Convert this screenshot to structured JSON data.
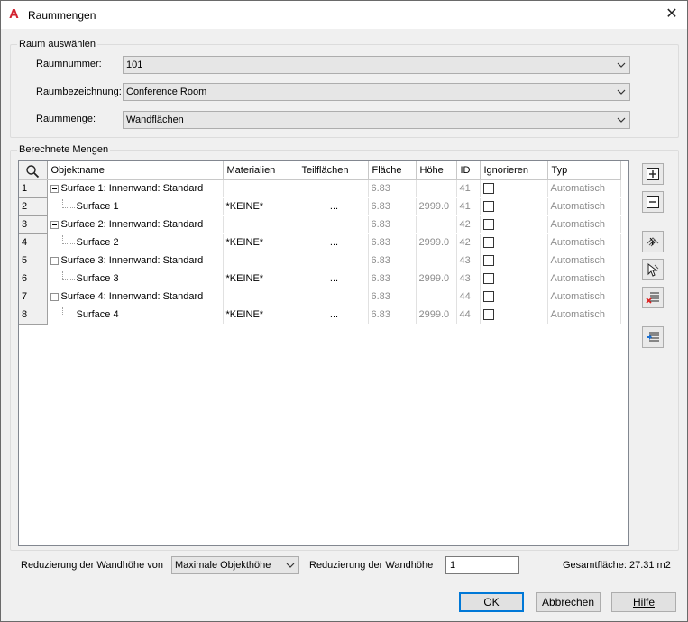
{
  "window": {
    "title": "Raummengen",
    "app_icon_glyph": "A",
    "close_glyph": "✕"
  },
  "select_room": {
    "group_label": "Raum auswählen",
    "room_number_label": "Raumnummer:",
    "room_number_value": "101",
    "room_name_label": "Raumbezeichnung:",
    "room_name_value": "Conference Room",
    "room_quantity_label": "Raummenge:",
    "room_quantity_value": "Wandflächen"
  },
  "computed": {
    "group_label": "Berechnete Mengen",
    "columns": [
      "Objektname",
      "Materialien",
      "Teilflächen",
      "Fläche",
      "Höhe",
      "ID",
      "Ignorieren",
      "Typ"
    ],
    "rows": [
      {
        "num": "1",
        "name": "Surface 1: Innenwand: Standard",
        "level": 0,
        "material": "",
        "parts": "",
        "area": "6.83",
        "height": "",
        "id": "41",
        "type": "Automatisch"
      },
      {
        "num": "2",
        "name": "Surface 1",
        "level": 1,
        "material": "*KEINE*",
        "parts": "...",
        "area": "6.83",
        "height": "2999.0",
        "id": "41",
        "type": "Automatisch"
      },
      {
        "num": "3",
        "name": "Surface 2: Innenwand: Standard",
        "level": 0,
        "material": "",
        "parts": "",
        "area": "6.83",
        "height": "",
        "id": "42",
        "type": "Automatisch"
      },
      {
        "num": "4",
        "name": "Surface 2",
        "level": 1,
        "material": "*KEINE*",
        "parts": "...",
        "area": "6.83",
        "height": "2999.0",
        "id": "42",
        "type": "Automatisch"
      },
      {
        "num": "5",
        "name": "Surface 3: Innenwand: Standard",
        "level": 0,
        "material": "",
        "parts": "",
        "area": "6.83",
        "height": "",
        "id": "43",
        "type": "Automatisch"
      },
      {
        "num": "6",
        "name": "Surface 3",
        "level": 1,
        "material": "*KEINE*",
        "parts": "...",
        "area": "6.83",
        "height": "2999.0",
        "id": "43",
        "type": "Automatisch"
      },
      {
        "num": "7",
        "name": "Surface 4: Innenwand: Standard",
        "level": 0,
        "material": "",
        "parts": "",
        "area": "6.83",
        "height": "",
        "id": "44",
        "type": "Automatisch"
      },
      {
        "num": "8",
        "name": "Surface 4",
        "level": 1,
        "material": "*KEINE*",
        "parts": "...",
        "area": "6.83",
        "height": "2999.0",
        "id": "44",
        "type": "Automatisch"
      }
    ]
  },
  "side_tools": [
    "expand-all-icon",
    "collapse-all-icon",
    "select-surface-icon",
    "pick-object-icon",
    "remove-list-icon",
    "edit-list-icon"
  ],
  "bottom": {
    "wall_reduction_from_label": "Reduzierung der Wandhöhe von",
    "wall_reduction_from_value": "Maximale Objekthöhe",
    "wall_reduction_label": "Reduzierung der Wandhöhe",
    "wall_reduction_value": "1",
    "total_area_label": "Gesamtfläche: 27.31 m2"
  },
  "buttons": {
    "ok": "OK",
    "cancel": "Abbrechen",
    "help": "Hilfe"
  }
}
